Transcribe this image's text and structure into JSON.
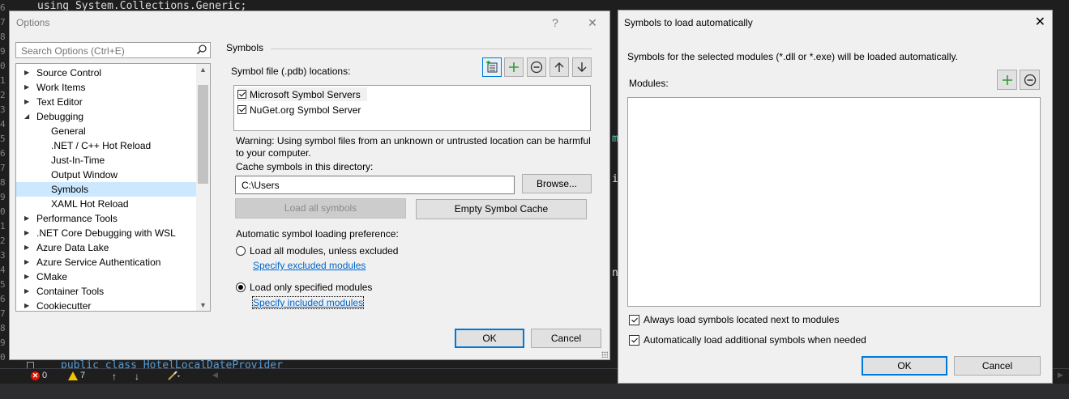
{
  "editor": {
    "code_top": "using System.Collections.Generic;",
    "code_bottom": "public class HotelLocalDateProvider",
    "line_numbers": [
      "6",
      "7",
      "8",
      "9",
      "0",
      "1",
      "2",
      "3",
      "4",
      "5",
      "6",
      "7",
      "8",
      "9",
      "0",
      "1",
      "2",
      "3",
      "4",
      "5",
      "6",
      "7",
      "8",
      "9",
      "0"
    ],
    "fragments": {
      "m": "m",
      "i": "i",
      "n": "n"
    }
  },
  "status_bar": {
    "errors": "0",
    "warnings": "7"
  },
  "options": {
    "title": "Options",
    "help_label": "?",
    "close_label": "✕",
    "search_placeholder": "Search Options (Ctrl+E)",
    "tree": [
      {
        "label": "Source Control",
        "level": 0,
        "expander": "▶"
      },
      {
        "label": "Work Items",
        "level": 0,
        "expander": "▶"
      },
      {
        "label": "Text Editor",
        "level": 0,
        "expander": "▶"
      },
      {
        "label": "Debugging",
        "level": 0,
        "expander": "◢"
      },
      {
        "label": "General",
        "level": 1,
        "expander": ""
      },
      {
        "label": ".NET / C++ Hot Reload",
        "level": 1,
        "expander": ""
      },
      {
        "label": "Just-In-Time",
        "level": 1,
        "expander": ""
      },
      {
        "label": "Output Window",
        "level": 1,
        "expander": ""
      },
      {
        "label": "Symbols",
        "level": 1,
        "expander": "",
        "selected": true
      },
      {
        "label": "XAML Hot Reload",
        "level": 1,
        "expander": ""
      },
      {
        "label": "Performance Tools",
        "level": 0,
        "expander": "▶"
      },
      {
        "label": ".NET Core Debugging with WSL",
        "level": 0,
        "expander": "▶"
      },
      {
        "label": "Azure Data Lake",
        "level": 0,
        "expander": "▶"
      },
      {
        "label": "Azure Service Authentication",
        "level": 0,
        "expander": "▶"
      },
      {
        "label": "CMake",
        "level": 0,
        "expander": "▶"
      },
      {
        "label": "Container Tools",
        "level": 0,
        "expander": "▶"
      },
      {
        "label": "Cookiecutter",
        "level": 0,
        "expander": "▶"
      }
    ],
    "symbols": {
      "section_title": "Symbols",
      "locations_label": "Symbol file (.pdb) locations:",
      "locations": [
        {
          "label": "Microsoft Symbol Servers",
          "checked": true
        },
        {
          "label": "NuGet.org Symbol Server",
          "checked": true
        }
      ],
      "warning_line1": "Warning: Using symbol files from an unknown or untrusted location can be harmful",
      "warning_line2": "to your computer.",
      "cache_label": "Cache symbols in this directory:",
      "cache_value": "C:\\Users",
      "browse_label": "Browse...",
      "load_all_label": "Load all symbols",
      "empty_cache_label": "Empty Symbol Cache",
      "preference_label": "Automatic symbol loading preference:",
      "radio_all_label": "Load all modules, unless excluded",
      "link_excluded": "Specify excluded modules",
      "radio_specified_label": "Load only specified modules",
      "link_included": "Specify included modules"
    },
    "ok_label": "OK",
    "cancel_label": "Cancel"
  },
  "auto_dialog": {
    "title": "Symbols to load automatically",
    "close_label": "✕",
    "description": "Symbols for the selected modules (*.dll or *.exe) will be loaded automatically.",
    "modules_label": "Modules:",
    "always_load_label": "Always load symbols located next to modules",
    "auto_additional_label": "Automatically load additional symbols when needed",
    "ok_label": "OK",
    "cancel_label": "Cancel"
  },
  "colors": {
    "accent": "#0078d7",
    "green_plus": "#2e9d2e",
    "selection": "#cce8ff",
    "link": "#0066cc"
  }
}
